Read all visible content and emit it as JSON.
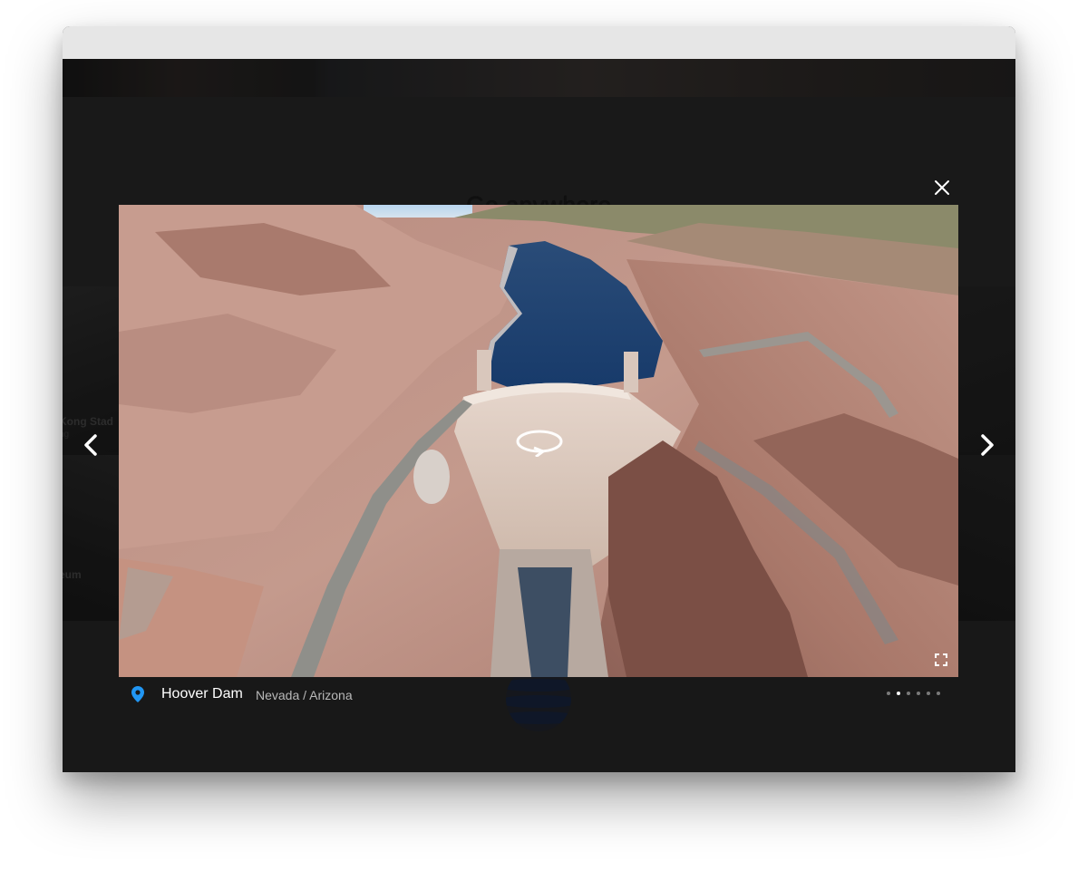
{
  "background_page": {
    "heading": "Go anywhere",
    "tiles": [
      {
        "caption": "Kong Stad",
        "sub": "ng"
      },
      {
        "caption": "eum",
        "sub": ""
      }
    ]
  },
  "lightbox": {
    "close_icon": "close-icon",
    "prev_icon": "chevron-left-icon",
    "next_icon": "chevron-right-icon",
    "image_subject": "aerial view of dam and reservoir",
    "rotate_icon": "rotate-360-icon",
    "fullscreen_icon": "fullscreen-icon",
    "location": {
      "icon": "map-pin-icon",
      "name": "Hoover Dam",
      "region": "Nevada / Arizona"
    },
    "pagination": {
      "count": 6,
      "active_index": 1
    }
  },
  "colors": {
    "pin": "#2196f3",
    "backdrop": "#181818",
    "text_primary": "#ffffff",
    "text_secondary": "#b9b9b9"
  }
}
